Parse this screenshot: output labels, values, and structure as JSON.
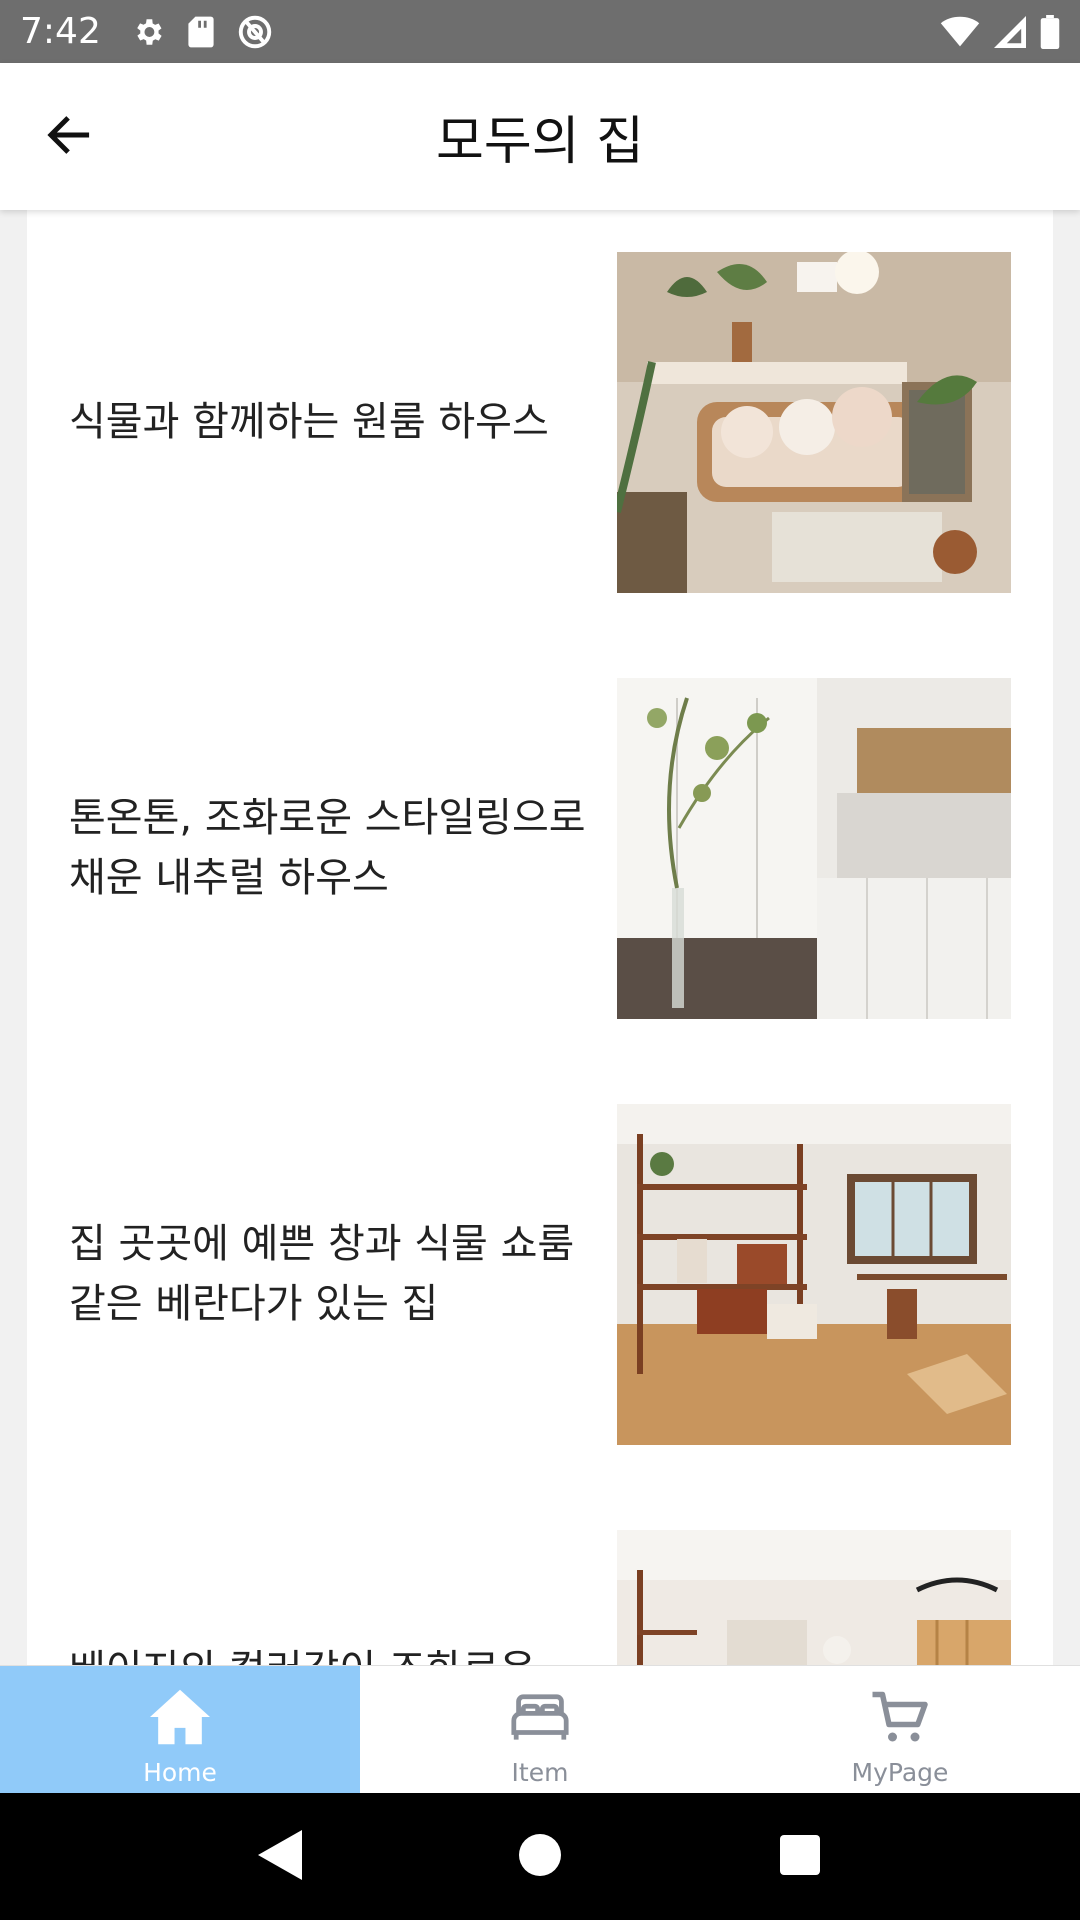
{
  "status_bar": {
    "time": "7:42",
    "left_icons": [
      "gear-icon",
      "sd-card-icon",
      "sync-icon"
    ],
    "right_icons": [
      "wifi-icon",
      "signal-icon",
      "battery-icon"
    ]
  },
  "app_bar": {
    "title": "모두의 집",
    "back_icon": "arrow-left-icon"
  },
  "cards": [
    {
      "title": "식물과 함께하는 원룸 하우스",
      "image": "room-with-plants-photo"
    },
    {
      "title": "톤온톤, 조화로운 스타일링으로 채운 내추럴 하우스",
      "image": "white-kitchen-photo"
    },
    {
      "title": "집 곳곳에 예쁜 창과 식물 쇼룸 같은 베란다가 있는 집",
      "image": "wood-shelf-room-photo"
    },
    {
      "title": "베이지의 컬러감이 조화로운",
      "image": "beige-living-room-photo"
    }
  ],
  "bottom_nav": {
    "items": [
      {
        "label": "Home",
        "icon": "home-icon",
        "active": true
      },
      {
        "label": "Item",
        "icon": "bed-icon",
        "active": false
      },
      {
        "label": "MyPage",
        "icon": "cart-icon",
        "active": false
      }
    ]
  },
  "colors": {
    "status_bar": "#6e6e6e",
    "nav_active": "#90caf9",
    "nav_inactive": "#8a8f99",
    "background": "#f1f1f1"
  },
  "system_nav": [
    "back-triangle-icon",
    "home-circle-icon",
    "recents-square-icon"
  ]
}
